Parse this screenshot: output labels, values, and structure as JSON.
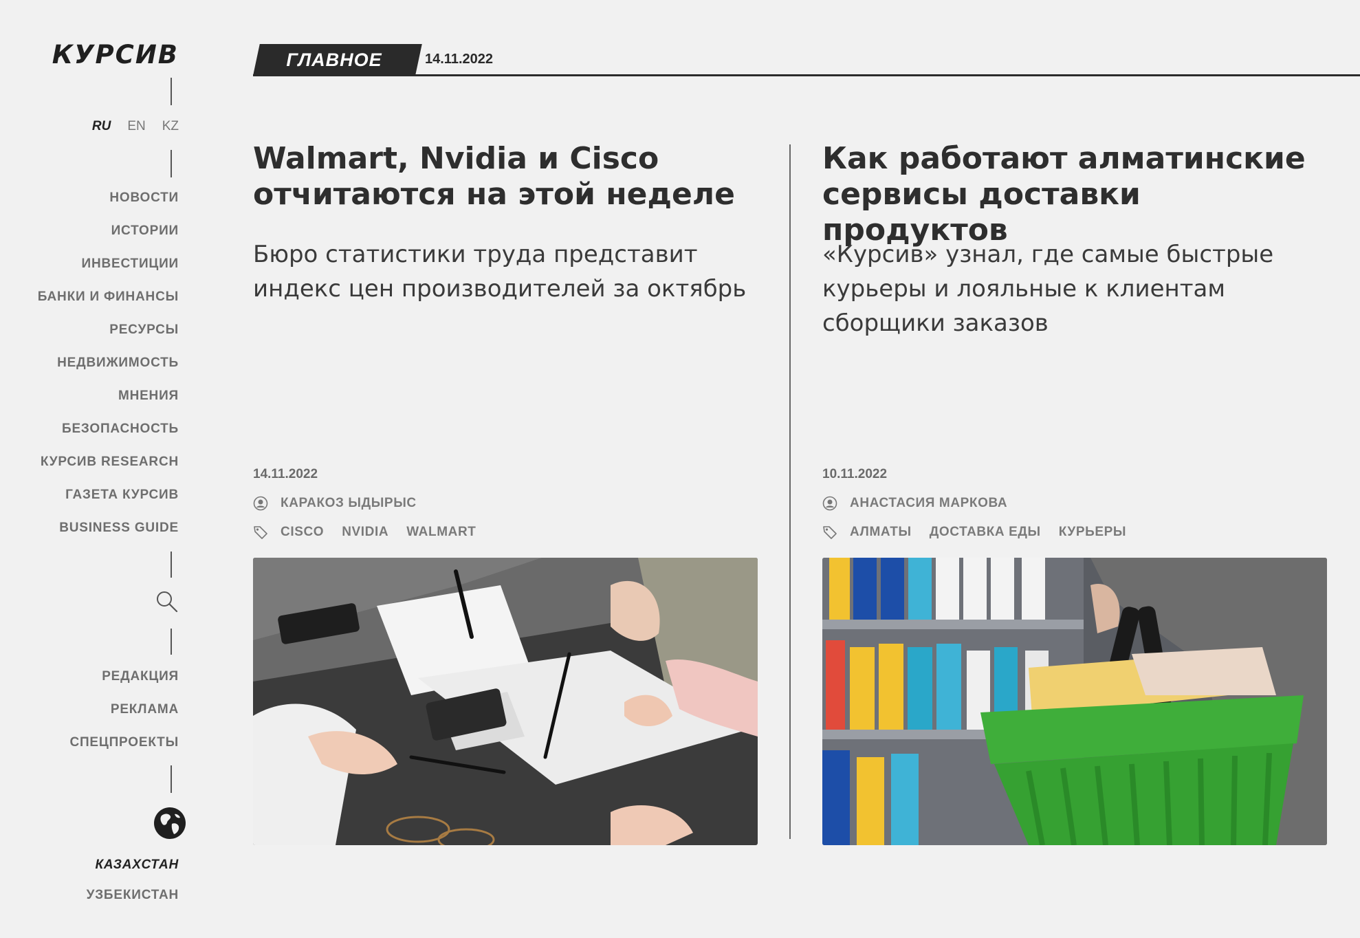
{
  "sidebar": {
    "logo": "КУРСИВ",
    "languages": [
      {
        "label": "RU",
        "active": true
      },
      {
        "label": "EN",
        "active": false
      },
      {
        "label": "KZ",
        "active": false
      }
    ],
    "nav": [
      "НОВОСТИ",
      "ИСТОРИИ",
      "ИНВЕСТИЦИИ",
      "БАНКИ И ФИНАНСЫ",
      "РЕСУРСЫ",
      "НЕДВИЖИМОСТЬ",
      "МНЕНИЯ",
      "БЕЗОПАСНОСТЬ",
      "КУРСИВ RESEARCH",
      "ГАЗЕТА КУРСИВ",
      "BUSINESS GUIDE"
    ],
    "secondary_nav": [
      "РЕДАКЦИЯ",
      "РЕКЛАМА",
      "СПЕЦПРОЕКТЫ"
    ],
    "countries": [
      {
        "label": "КАЗАХСТАН",
        "active": true
      },
      {
        "label": "УЗБЕКИСТАН",
        "active": false
      }
    ],
    "icons": {
      "search": "search-icon",
      "globe": "globe-icon"
    }
  },
  "header": {
    "section": "ГЛАВНОЕ",
    "date": "14.11.2022"
  },
  "articles": [
    {
      "title": "Walmart, Nvidia и Cisco отчитаются на этой неделе",
      "lead": "Бюро статистики труда представит индекс цен производителей за октябрь",
      "date": "14.11.2022",
      "author": "КАРАКОЗ ЫДЫРЫС",
      "tags": [
        "CISCO",
        "NVIDIA",
        "WALMART"
      ]
    },
    {
      "title": "Как работают алматинские сервисы доставки продуктов",
      "lead": "«Курсив» узнал, где самые быстрые курьеры и лояльные к клиентам сборщики заказов",
      "date": "10.11.2022",
      "author": "АНАСТАСИЯ МАРКОВА",
      "tags": [
        "АЛМАТЫ",
        "ДОСТАВКА ЕДЫ",
        "КУРЬЕРЫ"
      ]
    }
  ],
  "colors": {
    "background": "#f1f1f1",
    "badge": "#2a2a2a",
    "text": "#333333",
    "muted": "#6e6e6e",
    "basket_green": "#3fae3a"
  }
}
